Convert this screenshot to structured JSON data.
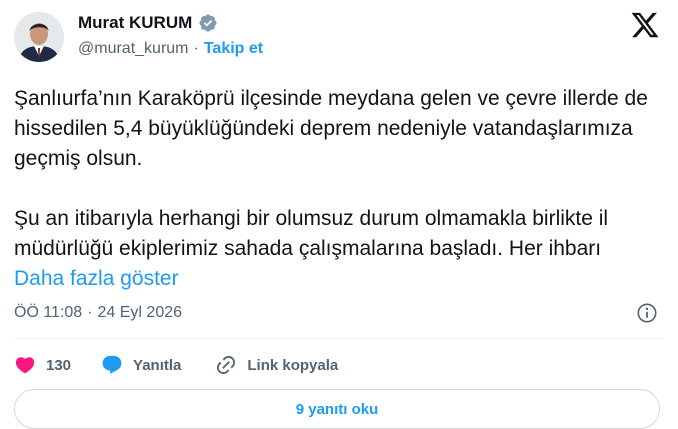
{
  "author": {
    "name": "Murat KURUM",
    "handle": "@murat_kurum",
    "separator": "·",
    "follow_label": "Takip et"
  },
  "tweet": {
    "paragraph1": "Şanlıurfa’nın Karaköprü ilçesinde meydana gelen ve çevre illerde de hissedilen 5,4 büyüklüğündeki deprem nedeniyle vatandaşlarımıza geçmiş olsun.",
    "paragraph2": "Şu an itibarıyla herhangi bir olumsuz  durum olmamakla birlikte il müdürlüğü ekiplerimiz sahada çalışmalarına başladı. Her ihbarı ",
    "show_more": "Daha fazla göster"
  },
  "meta": {
    "time": "ÖÖ 11:08",
    "separator": "·",
    "date": "24 Eyl 2026"
  },
  "actions": {
    "like_count": "130",
    "reply_label": "Yanıtla",
    "copy_link_label": "Link kopyala"
  },
  "replies_button": "9 yanıtı oku",
  "icons": {
    "verified": "verified-badge-icon",
    "logo": "x-logo-icon",
    "info": "info-icon",
    "like": "heart-icon",
    "reply": "reply-bubble-icon",
    "link": "link-icon"
  },
  "colors": {
    "accent": "#1d9bf0",
    "like": "#f91880",
    "muted": "#536471",
    "text": "#0f1419"
  }
}
